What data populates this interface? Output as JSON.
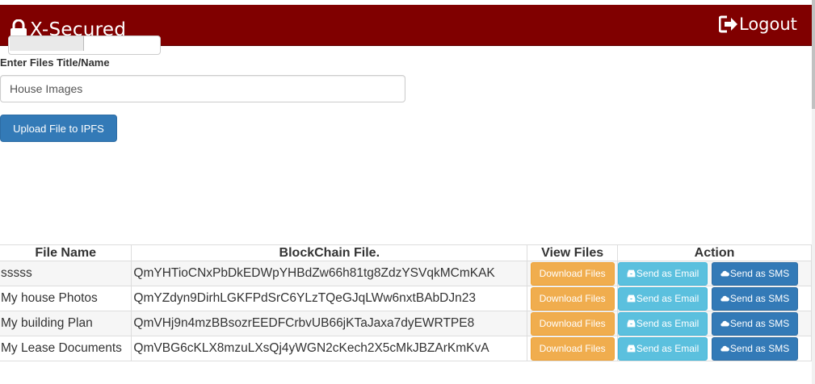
{
  "header": {
    "brand": "X-Secured",
    "brand_icon": "lock-icon",
    "logout_label": "Logout",
    "logout_icon": "logout-icon",
    "background_color": "#800000"
  },
  "upload_form": {
    "title_label": "Enter Files Title/Name",
    "title_value": "House Images",
    "upload_button": "Upload File to IPFS"
  },
  "files_table": {
    "columns": [
      "File Name",
      "BlockChain File.",
      "View Files",
      "Action"
    ],
    "rows": [
      {
        "name": "sssss",
        "hash": "QmYHTioCNxPbDkEDWpYHBdZw66h81tg8ZdzYSVqkMCmKAK",
        "view": "Download Files",
        "email": "Send as Email",
        "sms": "Send as SMS"
      },
      {
        "name": "My house Photos",
        "hash": "QmYZdyn9DirhLGKFPdSrC6YLzTQeGJqLWw6nxtBAbDJn23",
        "view": "Download Files",
        "email": "Send as Email",
        "sms": "Send as SMS"
      },
      {
        "name": "My building Plan",
        "hash": "QmVHj9n4mzBBsozrEEDFCrbvUB66jKTaJaxa7dyEWRTPE8",
        "view": "Download Files",
        "email": "Send as Email",
        "sms": "Send as SMS"
      },
      {
        "name": "My Lease Documents",
        "hash": "QmVBG6cKLX8mzuLXsQj4yWGN2cKech2X5cMkJBZArKmKvA",
        "view": "Download Files",
        "email": "Send as Email",
        "sms": "Send as SMS"
      }
    ]
  },
  "colors": {
    "primary": "#337ab7",
    "warning": "#f0ad4e",
    "info": "#5bc0de"
  }
}
